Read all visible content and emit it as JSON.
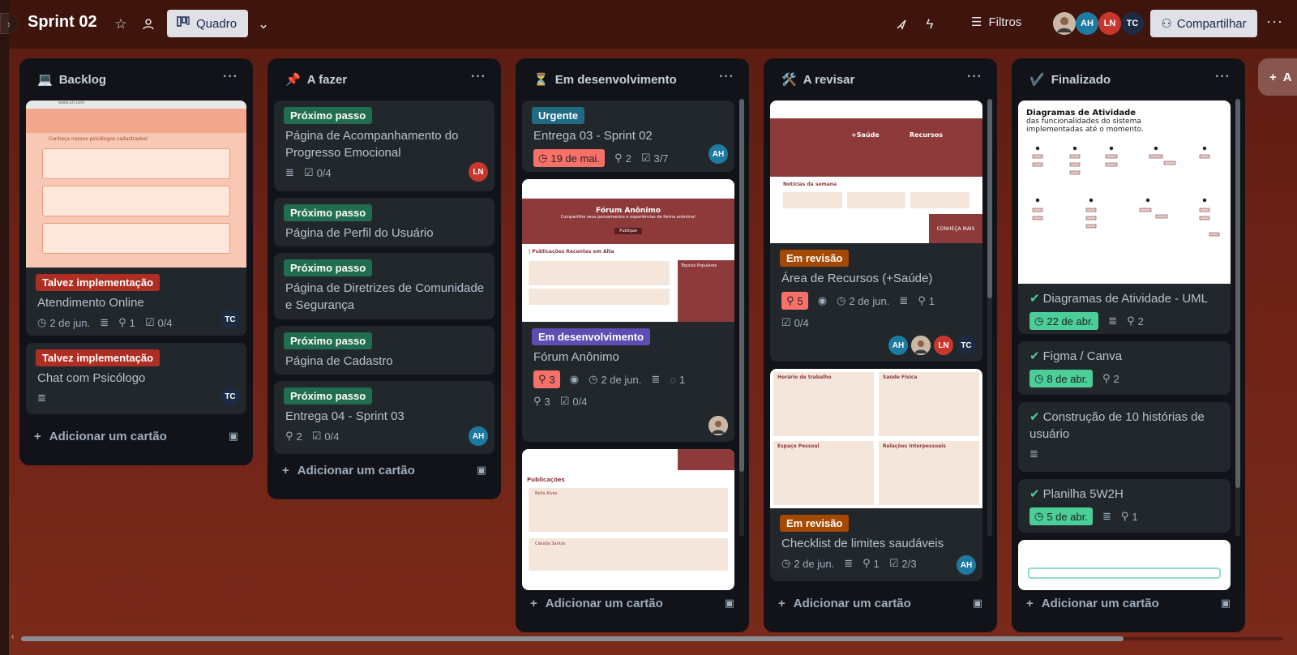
{
  "board": {
    "title": "Sprint 02",
    "view_label": "Quadro",
    "filters_label": "Filtros",
    "share_label": "Compartilhar",
    "add_list_label": "A"
  },
  "members": [
    "AH",
    "LN",
    "TC"
  ],
  "add_card_label": "Adicionar um cartão",
  "lists": [
    {
      "emoji": "💻",
      "title": "Backlog",
      "cards": [
        {
          "label": "Talvez implementação",
          "title": "Atendimento Online",
          "date": "2 de jun.",
          "attachments": "1",
          "checklist": "0/4",
          "member": "TC"
        },
        {
          "label": "Talvez implementação",
          "title": "Chat com Psicólogo",
          "member": "TC"
        }
      ]
    },
    {
      "emoji": "📌",
      "title": "A fazer",
      "cards": [
        {
          "label": "Próximo passo",
          "title": "Página de Acompanhamento do Progresso Emocional",
          "checklist": "0/4",
          "member": "LN"
        },
        {
          "label": "Próximo passo",
          "title": "Página de Perfil do Usuário"
        },
        {
          "label": "Próximo passo",
          "title": "Página de Diretrizes de Comunidade e Segurança"
        },
        {
          "label": "Próximo passo",
          "title": "Página de Cadastro"
        },
        {
          "label": "Próximo passo",
          "title": "Entrega 04 - Sprint 03",
          "attachments": "2",
          "checklist": "0/4",
          "member": "AH"
        }
      ]
    },
    {
      "emoji": "⏳",
      "title": "Em desenvolvimento",
      "cards": [
        {
          "label": "Urgente",
          "title": "Entrega 03 - Sprint 02",
          "date": "19 de mai.",
          "attachments": "2",
          "checklist": "3/7",
          "member": "AH"
        },
        {
          "label": "Em desenvolvimento",
          "title": "Fórum Anônimo",
          "votes": "3",
          "date": "2 de jun.",
          "comments": "1",
          "attachments": "3",
          "checklist": "0/4"
        }
      ]
    },
    {
      "emoji": "🛠️",
      "title": "A revisar",
      "cards": [
        {
          "label": "Em revisão",
          "title": "Área de Recursos (+Saúde)",
          "votes": "5",
          "date": "2 de jun.",
          "attachments": "1",
          "checklist": "0/4",
          "members": [
            "AH",
            "LN",
            "TC"
          ]
        },
        {
          "label": "Em revisão",
          "title": "Checklist de limites saudáveis",
          "date": "2 de jun.",
          "attachments": "1",
          "checklist": "2/3",
          "member": "AH"
        }
      ]
    },
    {
      "emoji": "✔️",
      "title": "Finalizado",
      "cards": [
        {
          "title": "Diagramas de Atividade - UML",
          "date": "22 de abr.",
          "attachments": "2"
        },
        {
          "title": "Figma / Canva",
          "date": "8 de abr.",
          "attachments": "2"
        },
        {
          "title": "Construção de 10 histórias de usuário"
        },
        {
          "title": "Planilha 5W2H",
          "date": "5 de abr.",
          "attachments": "1"
        }
      ]
    }
  ],
  "covers": {
    "backlog_url": "www.url.com",
    "backlog_heading": "Conheça nossos psicólogos cadastrados!",
    "forum_title": "Fórum Anônimo",
    "forum_sub": "Compartilhe seus pensamentos e experiências de forma anônima!",
    "forum_btn": "Publique",
    "forum_section": "| Publicações Recentes em Alta",
    "forum_topics": "Tópicos Populares",
    "forum_publicacoes": "Publicações",
    "forum_user1": "Bella Alves",
    "forum_user2": "Cláudia Santos",
    "saude_title": "+Saúde",
    "recursos_title": "Recursos",
    "noticias": "Notícias da semana",
    "conheca": "CONHEÇA MAIS",
    "checklist_h1": "Horário de trabalho",
    "checklist_h2": "Saúde Física",
    "checklist_h3": "Espaço Pessoal",
    "checklist_h4": "Relações Interpessoais",
    "diagram_title": "Diagramas de Atividade",
    "diagram_sub": "das funcionalidades do sistema implementadas até o momento."
  },
  "colors": {
    "AH": "#1d7aa1",
    "LN": "#c9372c",
    "TC": "#1c2b41"
  }
}
